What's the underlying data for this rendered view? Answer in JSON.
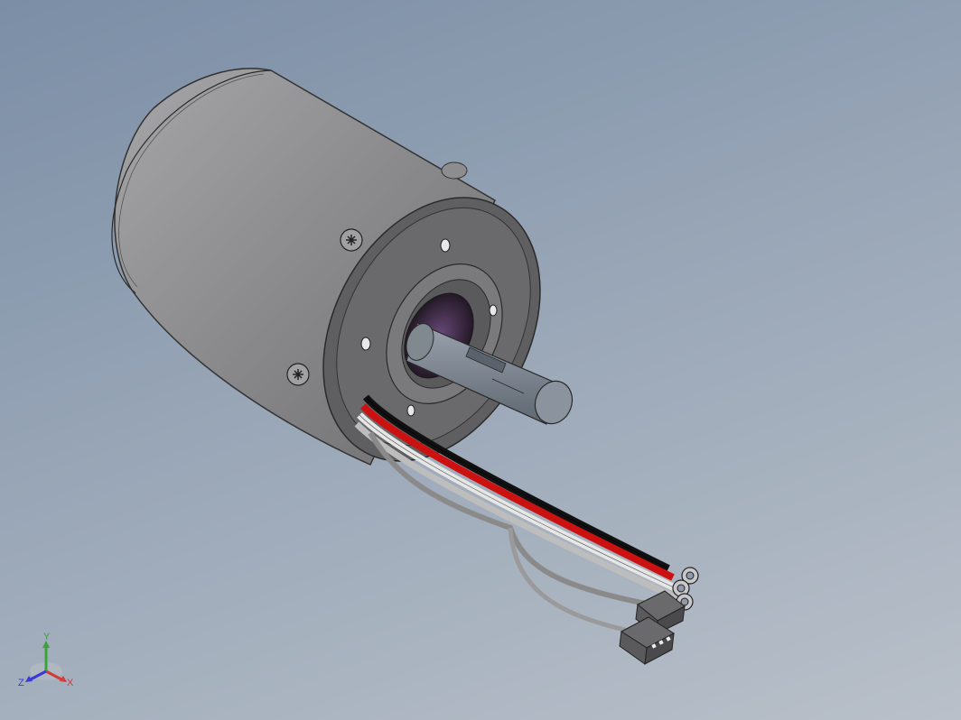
{
  "viewport": {
    "background_top": "#7b8ea6",
    "background_bottom": "#b9c0c9"
  },
  "model": {
    "body_color": "#8f8f91",
    "end_plate_color": "#6a6a6c",
    "shaft_color": "#7f8894",
    "bearing_color": "#3a2a44",
    "wire_colors": [
      "#cc1111",
      "#111111",
      "#e6e6e6",
      "#c8c8c8",
      "#8a8a8a"
    ],
    "connector_color": "#555558"
  },
  "triad": {
    "x_label": "X",
    "y_label": "Y",
    "z_label": "Z",
    "x_color": "#d43a3a",
    "y_color": "#3aa43a",
    "z_color": "#3a3ad4"
  }
}
